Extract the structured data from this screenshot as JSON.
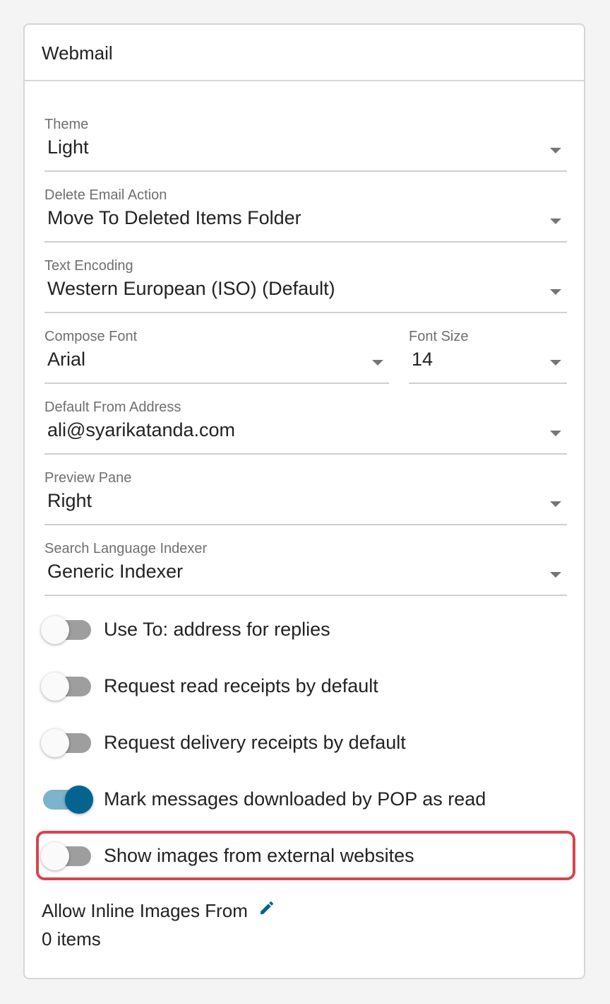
{
  "panel": {
    "title": "Webmail"
  },
  "fields": {
    "theme": {
      "label": "Theme",
      "value": "Light"
    },
    "delete_action": {
      "label": "Delete Email Action",
      "value": "Move To Deleted Items Folder"
    },
    "text_encoding": {
      "label": "Text Encoding",
      "value": "Western European (ISO) (Default)"
    },
    "compose_font": {
      "label": "Compose Font",
      "value": "Arial"
    },
    "font_size": {
      "label": "Font Size",
      "value": "14"
    },
    "from_address": {
      "label": "Default From Address",
      "value": "ali@syarikatanda.com"
    },
    "preview_pane": {
      "label": "Preview Pane",
      "value": "Right"
    },
    "search_indexer": {
      "label": "Search Language Indexer",
      "value": "Generic Indexer"
    }
  },
  "toggles": [
    {
      "label": "Use To: address for replies",
      "on": false
    },
    {
      "label": "Request read receipts by default",
      "on": false
    },
    {
      "label": "Request delivery receipts by default",
      "on": false
    },
    {
      "label": "Mark messages downloaded by POP as read",
      "on": true
    },
    {
      "label": "Show images from external websites",
      "on": false
    }
  ],
  "inline_images": {
    "title": "Allow Inline Images From",
    "count": "0 items"
  },
  "colors": {
    "accent": "#03658f",
    "highlight_border": "#d6454d",
    "switch_off_track": "#9e9e9e",
    "switch_on_track": "#7db3cc"
  },
  "icons": {
    "edit": "pencil-icon",
    "dropdown": "caret-down-icon"
  }
}
